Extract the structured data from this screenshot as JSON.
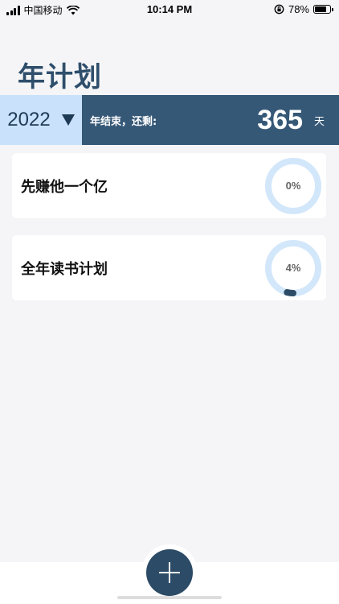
{
  "status_bar": {
    "carrier": "中国移动",
    "time": "10:14 PM",
    "battery_text": "78%",
    "battery_level": 0.78
  },
  "page": {
    "title": "年计划"
  },
  "year_banner": {
    "year": "2022",
    "remaining_label": "年结束，还剩:",
    "remaining_days": "365",
    "remaining_unit": "天"
  },
  "plans": [
    {
      "title": "先赚他一个亿",
      "progress": 0,
      "progress_text": "0%"
    },
    {
      "title": "全年读书计划",
      "progress": 4,
      "progress_text": "4%"
    }
  ],
  "colors": {
    "accent": "#365877",
    "ring_track": "#d3e7fb",
    "ring_fill": "#2c4b66"
  },
  "icons": {
    "signal": "signal-icon",
    "wifi": "wifi-icon",
    "orientation_lock": "orientation-lock-icon",
    "battery": "battery-icon",
    "dropdown": "caret-down-icon",
    "add": "plus-icon"
  }
}
